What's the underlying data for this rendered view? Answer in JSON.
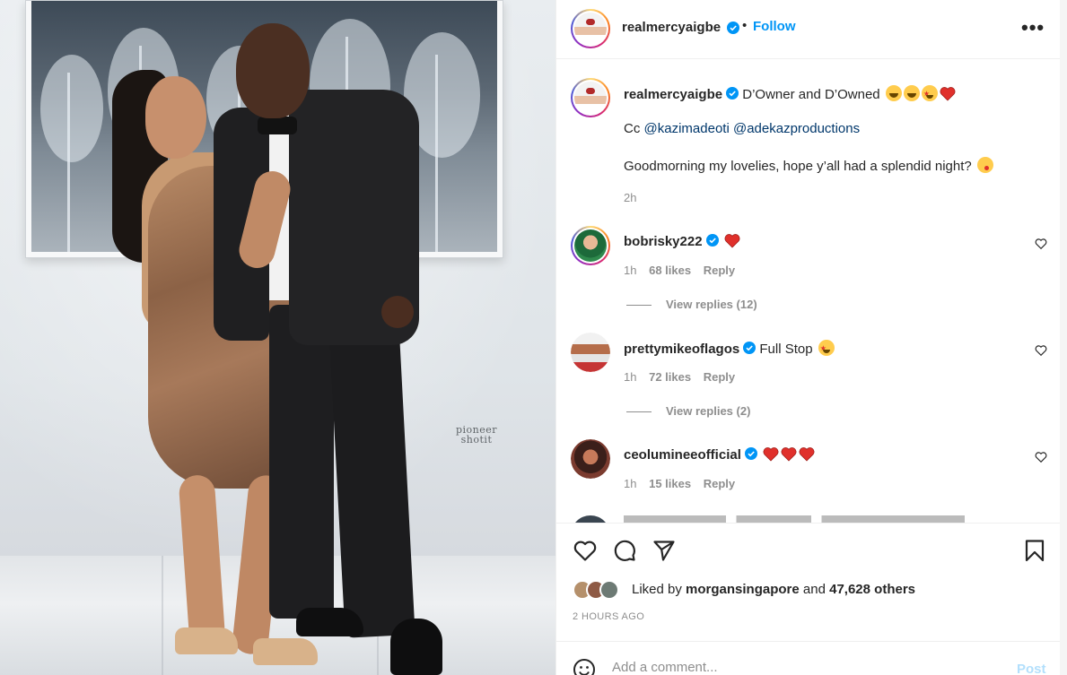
{
  "photo": {
    "watermark_line1": "pioneer",
    "watermark_line2": "shotit"
  },
  "header": {
    "username": "realmercyaigbe",
    "dot": "•",
    "follow_label": "Follow",
    "more_label": "•••"
  },
  "caption": {
    "username": "realmercyaigbe",
    "text": "D’Owner and D’Owned",
    "cc_label": "Cc",
    "mention1": "@kazimadeoti",
    "mention2": "@adekazproductions",
    "line3": "Goodmorning my lovelies, hope y’all had a splendid night?",
    "time": "2h"
  },
  "comments": [
    {
      "username": "bobrisky222",
      "time": "1h",
      "likes": "68 likes",
      "reply": "Reply",
      "replies": "View replies (12)"
    },
    {
      "username": "prettymikeoflagos",
      "text": "Full Stop",
      "time": "1h",
      "likes": "72 likes",
      "reply": "Reply",
      "replies": "View replies (2)"
    },
    {
      "username": "ceolumineeofficial",
      "time": "1h",
      "likes": "15 likes",
      "reply": "Reply"
    }
  ],
  "likes": {
    "prefix": "Liked by",
    "user": "morgansingapore",
    "middle": "and",
    "count": "47,628 others"
  },
  "timestamp": "2 HOURS AGO",
  "comment_box": {
    "placeholder": "Add a comment...",
    "post_label": "Post"
  },
  "colors": {
    "accent": "#0095f6",
    "text": "#262626",
    "muted": "#8e8e8e",
    "heart": "#ed4956"
  }
}
